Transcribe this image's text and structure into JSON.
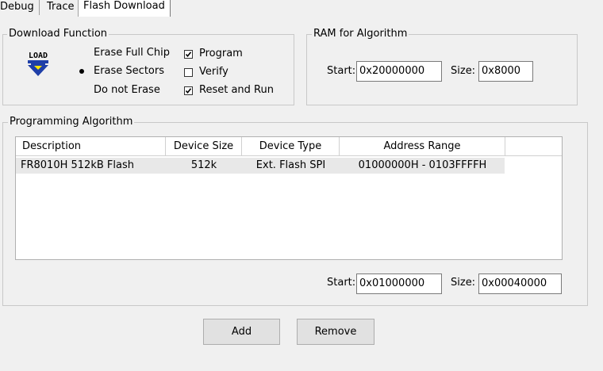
{
  "tabs": [
    {
      "label": "Debug"
    },
    {
      "label": "Trace"
    },
    {
      "label": "Flash Download"
    }
  ],
  "download_function": {
    "title": "Download Function",
    "icon": "load-icon",
    "icon_text": "LOAD",
    "options": [
      {
        "label": "Erase Full Chip",
        "selected": false
      },
      {
        "label": "Erase Sectors",
        "selected": true
      },
      {
        "label": "Do not Erase",
        "selected": false
      }
    ],
    "checks": [
      {
        "label": "Program",
        "checked": true
      },
      {
        "label": "Verify",
        "checked": false
      },
      {
        "label": "Reset and Run",
        "checked": true
      }
    ]
  },
  "ram": {
    "title": "RAM for Algorithm",
    "start_label": "Start:",
    "start_value": "0x20000000",
    "size_label": "Size:",
    "size_value": "0x8000"
  },
  "algorithm": {
    "title": "Programming Algorithm",
    "columns": [
      "Description",
      "Device Size",
      "Device Type",
      "Address Range"
    ],
    "rows": [
      [
        "FR8010H 512kB Flash",
        "512k",
        "Ext. Flash SPI",
        "01000000H - 0103FFFFH"
      ]
    ],
    "start_label": "Start:",
    "start_value": "0x01000000",
    "size_label": "Size:",
    "size_value": "0x00040000"
  },
  "buttons": {
    "add": "Add",
    "remove": "Remove"
  }
}
